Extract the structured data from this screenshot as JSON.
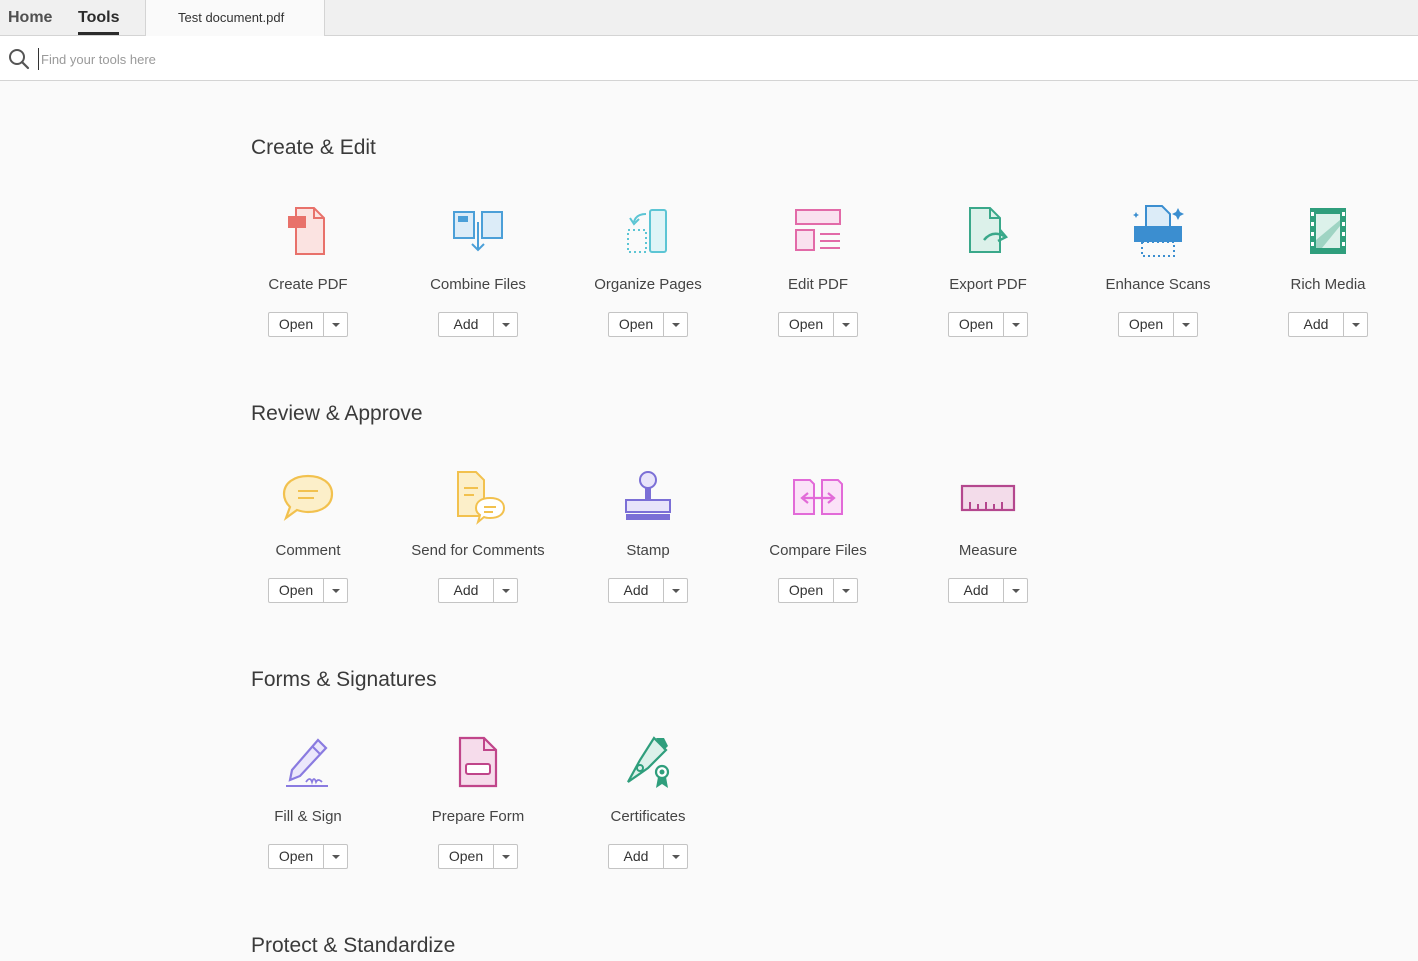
{
  "nav": {
    "home": "Home",
    "tools": "Tools",
    "document_tab": "Test document.pdf"
  },
  "search": {
    "placeholder": "Find your tools here",
    "value": ""
  },
  "sections": {
    "create_edit": {
      "title": "Create & Edit",
      "tools": [
        {
          "label": "Create PDF",
          "action": "Open",
          "icon": "create-pdf-icon",
          "color": "#e8716a"
        },
        {
          "label": "Combine Files",
          "action": "Add",
          "icon": "combine-files-icon",
          "color": "#4b9fd8"
        },
        {
          "label": "Organize Pages",
          "action": "Open",
          "icon": "organize-pages-icon",
          "color": "#5cc5d4"
        },
        {
          "label": "Edit PDF",
          "action": "Open",
          "icon": "edit-pdf-icon",
          "color": "#e26aa8"
        },
        {
          "label": "Export PDF",
          "action": "Open",
          "icon": "export-pdf-icon",
          "color": "#3aa88a"
        },
        {
          "label": "Enhance Scans",
          "action": "Open",
          "icon": "enhance-scans-icon",
          "color": "#3b8ed0"
        },
        {
          "label": "Rich Media",
          "action": "Add",
          "icon": "rich-media-icon",
          "color": "#2f9e7c"
        }
      ]
    },
    "review_approve": {
      "title": "Review & Approve",
      "tools": [
        {
          "label": "Comment",
          "action": "Open",
          "icon": "comment-icon",
          "color": "#f2c14e"
        },
        {
          "label": "Send for Comments",
          "action": "Add",
          "icon": "send-for-comments-icon",
          "color": "#f2c14e"
        },
        {
          "label": "Stamp",
          "action": "Add",
          "icon": "stamp-icon",
          "color": "#7b6fd6"
        },
        {
          "label": "Compare Files",
          "action": "Open",
          "icon": "compare-files-icon",
          "color": "#e26ad8"
        },
        {
          "label": "Measure",
          "action": "Add",
          "icon": "measure-icon",
          "color": "#b4478e"
        }
      ]
    },
    "forms_signatures": {
      "title": "Forms & Signatures",
      "tools": [
        {
          "label": "Fill & Sign",
          "action": "Open",
          "icon": "fill-sign-icon",
          "color": "#8a7be0"
        },
        {
          "label": "Prepare Form",
          "action": "Open",
          "icon": "prepare-form-icon",
          "color": "#c0458a"
        },
        {
          "label": "Certificates",
          "action": "Add",
          "icon": "certificates-icon",
          "color": "#2f9e7c"
        }
      ]
    },
    "protect_standardize": {
      "title": "Protect & Standardize"
    }
  }
}
